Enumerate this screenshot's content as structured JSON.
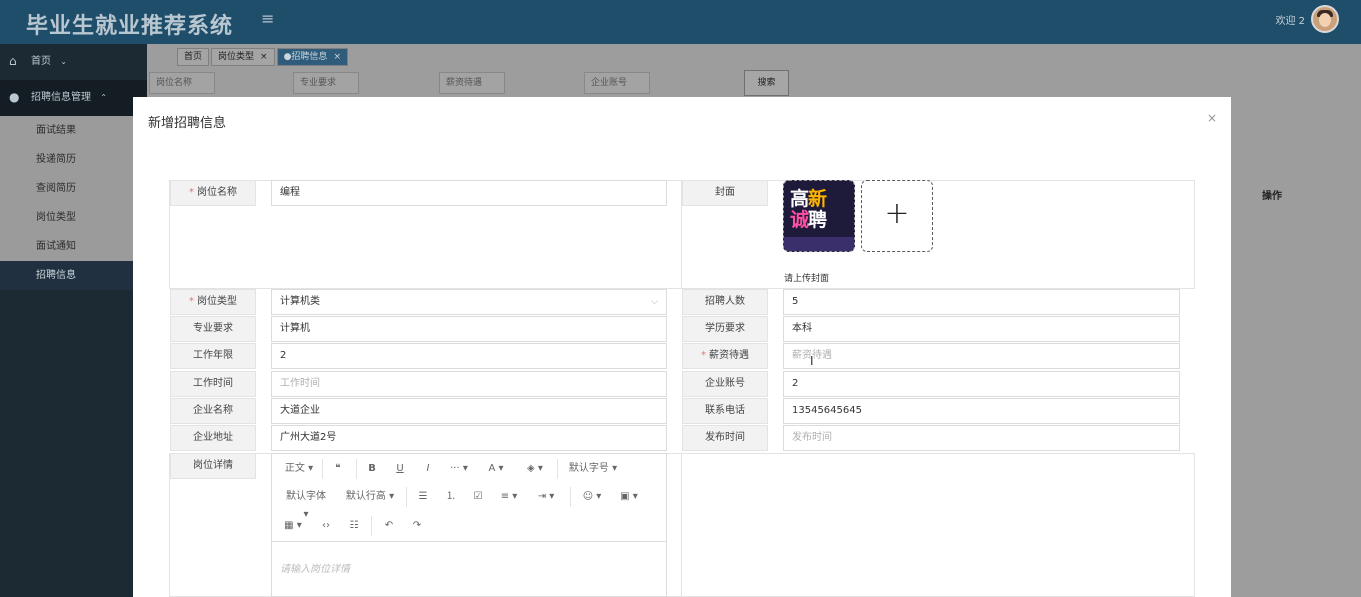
{
  "app": {
    "title": "毕业生就业推荐系统",
    "menu_toggle_glyph": "≡"
  },
  "header": {
    "welcome": "欢迎 2"
  },
  "sidebar": {
    "home": {
      "label": "首页",
      "icon": "home-icon",
      "chev": "⌄"
    },
    "group": {
      "label": "招聘信息管理",
      "icon": "check-circle-icon",
      "chev": "⌃"
    },
    "items": [
      {
        "label": "面试结果"
      },
      {
        "label": "投递简历"
      },
      {
        "label": "查阅简历"
      },
      {
        "label": "岗位类型"
      },
      {
        "label": "面试通知"
      },
      {
        "label": "招聘信息",
        "active": true
      }
    ]
  },
  "tabs": [
    {
      "label": "首页"
    },
    {
      "label": "岗位类型",
      "close": "×"
    },
    {
      "label": "●招聘信息",
      "close": "×",
      "current": true
    }
  ],
  "search": {
    "fields": [
      "岗位名称",
      "专业要求",
      "薪资待遇",
      "企业账号"
    ],
    "button": "搜索"
  },
  "table": {
    "op_header": "操作"
  },
  "modal": {
    "title": "新增招聘信息",
    "close": "×",
    "left": {
      "job_name": {
        "label": "岗位名称",
        "required": "*",
        "value": "编程"
      },
      "job_type": {
        "label": "岗位类型",
        "required": "*",
        "value": "计算机类",
        "arrow": "⌵"
      },
      "major": {
        "label": "专业要求",
        "value": "计算机"
      },
      "years": {
        "label": "工作年限",
        "value": "2"
      },
      "work_time": {
        "label": "工作时间",
        "placeholder": "工作时间"
      },
      "company": {
        "label": "企业名称",
        "value": "大道企业"
      },
      "address": {
        "label": "企业地址",
        "value": "广州大道2号"
      },
      "detail": {
        "label": "岗位详情"
      }
    },
    "right": {
      "cover": {
        "label": "封面",
        "hint": "请上传封面",
        "plus": "+",
        "img_line1a": "高",
        "img_line1b": "新",
        "img_line2a": "诚",
        "img_line2b": "聘"
      },
      "headcount": {
        "label": "招聘人数",
        "value": "5"
      },
      "education": {
        "label": "学历要求",
        "value": "本科"
      },
      "salary": {
        "label": "薪资待遇",
        "required": "*",
        "placeholder": "薪资待遇"
      },
      "account": {
        "label": "企业账号",
        "value": "2"
      },
      "phone": {
        "label": "联系电话",
        "value": "13545645645"
      },
      "publish": {
        "label": "发布时间",
        "placeholder": "发布时间"
      }
    },
    "editor": {
      "row1": [
        "正文 ▾",
        "❝",
        "B",
        "U",
        "I",
        "··· ▾",
        "A ▾",
        "◈ ▾",
        "默认字号 ▾"
      ],
      "row2": [
        "默认字体 ▾",
        "默认行高 ▾",
        "☰",
        "⒈",
        "☑",
        "≡ ▾",
        "⇥ ▾",
        "☺ ▾",
        "▣ ▾"
      ],
      "row3": [
        "▦ ▾",
        "‹›",
        "☷",
        "↶",
        "↷"
      ],
      "placeholder": "请输入岗位详情"
    }
  }
}
